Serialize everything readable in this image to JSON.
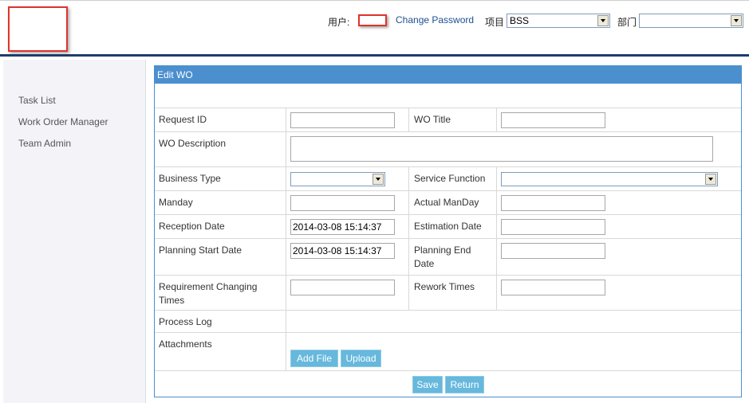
{
  "header": {
    "user_label": "用户:",
    "change_password": "Change Password",
    "project_label": "项目",
    "project_value": "BSS",
    "dept_label": "部门",
    "dept_value": ""
  },
  "sidebar": {
    "items": [
      {
        "label": "Task List"
      },
      {
        "label": "Work Order Manager"
      },
      {
        "label": "Team Admin"
      }
    ]
  },
  "form": {
    "title": "Edit WO",
    "request_id_label": "Request ID",
    "request_id_value": "",
    "wo_title_label": "WO Title",
    "wo_title_value": "",
    "wo_description_label": "WO Description",
    "wo_description_value": "",
    "business_type_label": "Business Type",
    "business_type_value": "",
    "service_function_label": "Service Function",
    "service_function_value": "",
    "manday_label": "Manday",
    "manday_value": "",
    "actual_manday_label": "Actual ManDay",
    "actual_manday_value": "",
    "reception_date_label": "Reception Date",
    "reception_date_value": "2014-03-08 15:14:37",
    "estimation_date_label": "Estimation Date",
    "estimation_date_value": "",
    "planning_start_label": "Planning Start Date",
    "planning_start_value": "2014-03-08 15:14:37",
    "planning_end_label": "Planning End Date",
    "planning_end_value": "",
    "req_changing_label": "Requirement Changing Times",
    "req_changing_value": "",
    "rework_label": "Rework Times",
    "rework_value": "",
    "process_log_label": "Process Log",
    "attachments_label": "Attachments",
    "add_file_button": "Add File",
    "upload_button": "Upload",
    "save_button": "Save",
    "return_button": "Return"
  },
  "colors": {
    "accent_blue": "#4b8fce",
    "header_line": "#1f3d6e",
    "button_blue": "#66b8dc",
    "highlight_red": "#e0332a"
  }
}
